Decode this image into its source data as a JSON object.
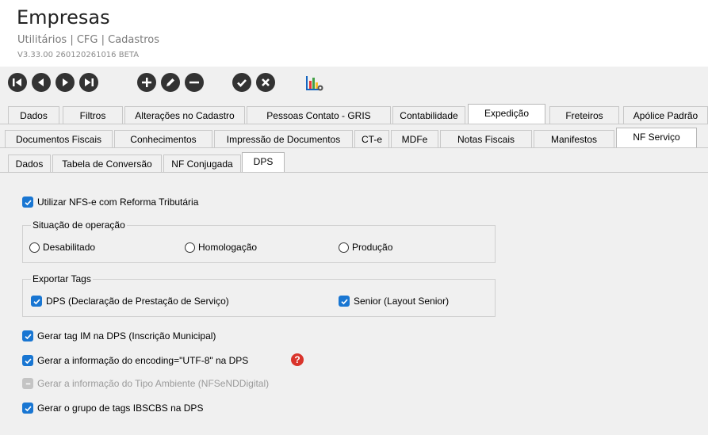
{
  "header": {
    "title": "Empresas",
    "subtitle": "Utilitários | CFG | Cadastros",
    "version": "V3.33.00 260120261016 BETA"
  },
  "toolbar": {
    "icons": [
      "first-icon",
      "previous-icon",
      "next-icon",
      "last-icon",
      "add-icon",
      "edit-icon",
      "remove-icon",
      "confirm-icon",
      "cancel-icon",
      "report-chart-icon"
    ]
  },
  "tabs_level1": [
    "Dados",
    "Filtros",
    "Alterações no Cadastro",
    "Pessoas Contato - GRIS",
    "Contabilidade",
    "Expedição",
    "Freteiros",
    "Apólice Padrão"
  ],
  "tabs_level2": [
    "Documentos Fiscais",
    "Conhecimentos",
    "Impressão de Documentos",
    "CT-e",
    "MDFe",
    "Notas Fiscais",
    "Manifestos",
    "NF Serviço"
  ],
  "tabs_level3": [
    "Dados",
    "Tabela de Conversão",
    "NF Conjugada",
    "DPS"
  ],
  "active": {
    "level1": "Expedição",
    "level2": "NF Serviço",
    "level3": "DPS"
  },
  "form": {
    "use_nfse": "Utilizar NFS-e com Reforma Tributária",
    "situacao": {
      "legend": "Situação de operação",
      "options": [
        "Desabilitado",
        "Homologação",
        "Produção"
      ]
    },
    "exportar": {
      "legend": "Exportar Tags",
      "dps": "DPS (Declaração de Prestação de Serviço)",
      "senior": "Senior (Layout Senior)"
    },
    "gerar_im": "Gerar tag IM na DPS (Inscrição Municipal)",
    "gerar_encoding": "Gerar a informação do encoding=\"UTF-8\" na DPS",
    "gerar_tipo_ambiente": "Gerar a informação do Tipo Ambiente (NFSeNDDigital)",
    "gerar_ibscbs": "Gerar o grupo de tags IBSCBS na DPS",
    "help": "?"
  },
  "colors": {
    "check": "#1976d2",
    "help": "#d9342b",
    "toolbar_icon": "#333333"
  }
}
